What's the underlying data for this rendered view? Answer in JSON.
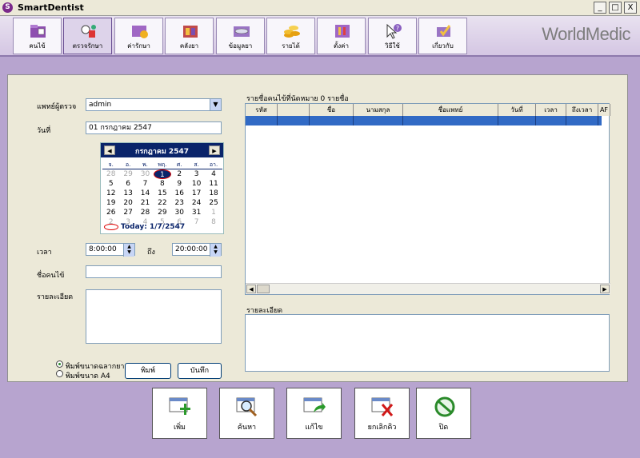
{
  "window": {
    "title": "SmartDentist",
    "app_icon": "S",
    "minimize": "_",
    "maximize": "□",
    "close": "X"
  },
  "brand": "WorldMedic",
  "toolbar": [
    {
      "label": "คนไข้",
      "icon": "patient-folder-icon"
    },
    {
      "label": "ตรวจรักษา",
      "icon": "examination-icon"
    },
    {
      "label": "ค่ารักษา",
      "icon": "treatment-fee-icon"
    },
    {
      "label": "คลังยา",
      "icon": "medicine-stock-icon"
    },
    {
      "label": "ข้อมูลยา",
      "icon": "medicine-data-icon"
    },
    {
      "label": "รายได้",
      "icon": "income-coins-icon"
    },
    {
      "label": "ตั้งค่า",
      "icon": "settings-icon"
    },
    {
      "label": "วิธีใช้",
      "icon": "help-icon"
    },
    {
      "label": "เกี่ยวกับ",
      "icon": "about-icon"
    }
  ],
  "form": {
    "doctor_label": "แพทย์ผู้ตรวจ",
    "doctor_value": "admin",
    "date_label": "วันที่",
    "date_value": "01 กรกฎาคม 2547",
    "time_label": "เวลา",
    "time_from": "8:00:00",
    "to_label": "ถึง",
    "time_to": "20:00:00",
    "patient_label": "ชื่อคนไข้",
    "detail_label": "รายละเอียด",
    "radio_small": "พิมพ์ขนาดฉลากยา",
    "radio_a4": "พิมพ์ขนาด A4",
    "print_button": "พิมพ์",
    "save_button": "บันทึก"
  },
  "calendar": {
    "month_year": "กรกฎาคม 2547",
    "prev": "◀",
    "next": "▶",
    "days": [
      "จ.",
      "อ.",
      "พ.",
      "พฤ.",
      "ศ.",
      "ส.",
      "อา."
    ],
    "weeks": [
      [
        "28",
        "29",
        "30",
        "1",
        "2",
        "3",
        "4"
      ],
      [
        "5",
        "6",
        "7",
        "8",
        "9",
        "10",
        "11"
      ],
      [
        "12",
        "13",
        "14",
        "15",
        "16",
        "17",
        "18"
      ],
      [
        "19",
        "20",
        "21",
        "22",
        "23",
        "24",
        "25"
      ],
      [
        "26",
        "27",
        "28",
        "29",
        "30",
        "31",
        "1"
      ],
      [
        "2",
        "3",
        "4",
        "5",
        "6",
        "7",
        "8"
      ]
    ],
    "today_text": "Today: 1/7/2547"
  },
  "appointments": {
    "title": "รายชื่อคนไข้ที่นัดหมาย  0  รายชื่อ",
    "columns": [
      "รหัส",
      "",
      "ชื่อ",
      "นามสกุล",
      "ชื่อแพทย์",
      "วันที่",
      "เวลา",
      "ถึงเวลา",
      "AF"
    ],
    "detail_label": "รายละเอียด",
    "scroll_left": "◀",
    "scroll_right": "▶"
  },
  "actions": [
    {
      "label": "เพิ่ม",
      "icon": "add-icon"
    },
    {
      "label": "ค้นหา",
      "icon": "search-icon"
    },
    {
      "label": "แก้ไข",
      "icon": "edit-icon"
    },
    {
      "label": "ยกเลิกคิว",
      "icon": "cancel-queue-icon"
    },
    {
      "label": "ปิด",
      "icon": "close-icon"
    }
  ]
}
